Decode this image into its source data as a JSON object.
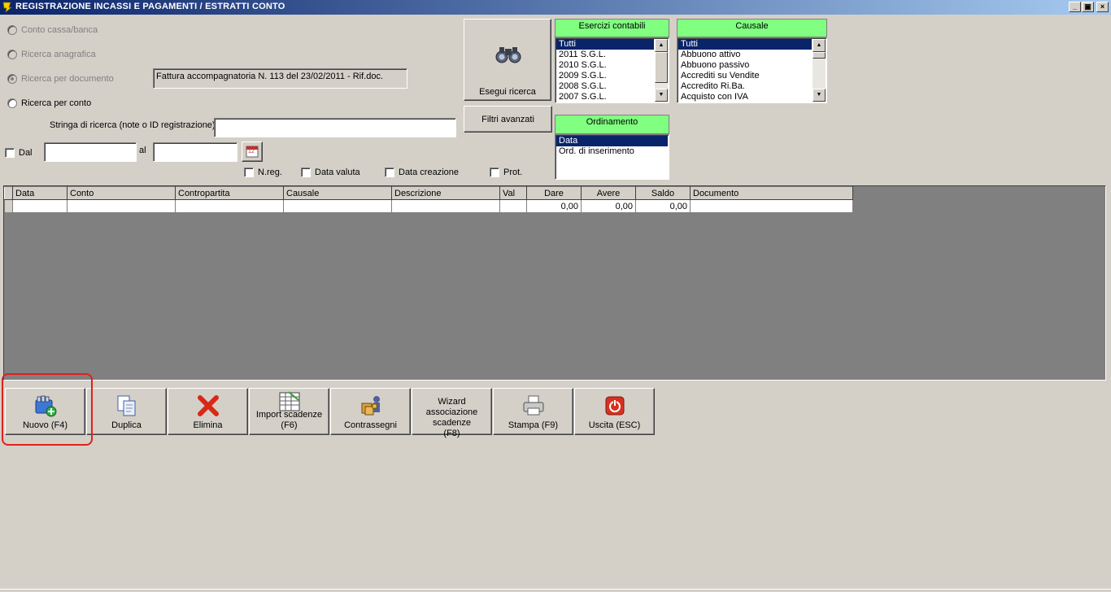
{
  "window": {
    "title": "REGISTRAZIONE INCASSI E PAGAMENTI / ESTRATTI CONTO",
    "minimize": "_",
    "restore": "▣",
    "close": "×"
  },
  "search": {
    "radio_conto_cassa": "Conto cassa/banca",
    "radio_anagrafica": "Ricerca anagrafica",
    "radio_documento": "Ricerca per documento",
    "radio_conto": "Ricerca per conto",
    "document_value": "Fattura accompagnatoria N. 113 del 23/02/2011 - Rif.doc.",
    "search_string_label": "Stringa di ricerca (note o ID registrazione)",
    "search_string_value": "",
    "dal_label": "Dal",
    "al_label": "al",
    "date_from": "",
    "date_to": "",
    "calendar_icon_text": "12",
    "chk_nreg": "N.reg.",
    "chk_data_valuta": "Data valuta",
    "chk_data_creazione": "Data creazione",
    "chk_prot": "Prot.",
    "execute_label": "Esegui ricerca",
    "advanced_label": "Filtri avanzati"
  },
  "esercizi": {
    "title": "Esercizi contabili",
    "items": [
      "Tutti",
      "2011 S.G.L.",
      "2010 S.G.L.",
      "2009 S.G.L.",
      "2008 S.G.L.",
      "2007 S.G.L."
    ],
    "selected": 0
  },
  "causale": {
    "title": "Causale",
    "items": [
      "Tutti",
      "Abbuono attivo",
      "Abbuono passivo",
      "Accrediti su Vendite",
      "Accredito Ri.Ba.",
      "Acquisto con IVA"
    ],
    "selected": 0
  },
  "ordinamento": {
    "title": "Ordinamento",
    "items": [
      "Data",
      "Ord. di inserimento"
    ],
    "selected": 0
  },
  "grid": {
    "columns": [
      "Data",
      "Conto",
      "Contropartita",
      "Causale",
      "Descrizione",
      "Val",
      "Dare",
      "Avere",
      "Saldo",
      "Documento"
    ],
    "row": [
      "",
      "",
      "",
      "",
      "",
      "",
      "0,00",
      "0,00",
      "0,00",
      ""
    ]
  },
  "toolbar": {
    "nuovo": "Nuovo (F4)",
    "duplica": "Duplica",
    "elimina": "Elimina",
    "import_scadenze": "Import scadenze (F6)",
    "contrassegni": "Contrassegni",
    "wizard": "Wizard associazione scadenze (F8)",
    "stampa": "Stampa (F9)",
    "uscita": "Uscita (ESC)"
  },
  "colors": {
    "titlebar_start": "#0a246a",
    "titlebar_end": "#a6caf0",
    "list_header": "#80ff80",
    "selection": "#0a246a",
    "highlight": "#e0201c"
  }
}
